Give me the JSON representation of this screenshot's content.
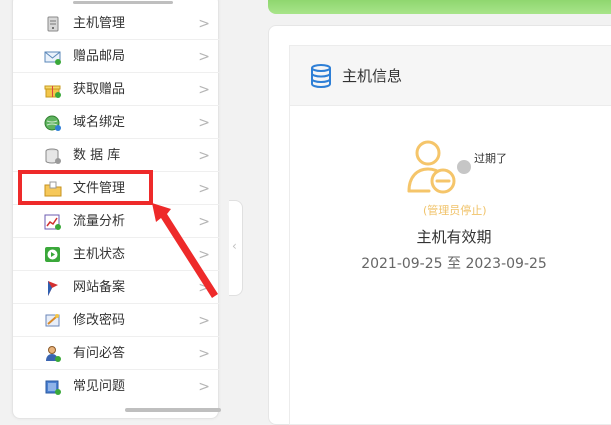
{
  "sidebar": {
    "items": [
      {
        "label": "主机管理",
        "icon": "server-icon"
      },
      {
        "label": "赠品邮局",
        "icon": "mail-icon"
      },
      {
        "label": "获取赠品",
        "icon": "gift-icon"
      },
      {
        "label": "域名绑定",
        "icon": "globe-icon"
      },
      {
        "label": "数 据 库",
        "icon": "database-icon"
      },
      {
        "label": "文件管理",
        "icon": "folder-icon"
      },
      {
        "label": "流量分析",
        "icon": "chart-icon"
      },
      {
        "label": "主机状态",
        "icon": "play-icon"
      },
      {
        "label": "网站备案",
        "icon": "flag-icon"
      },
      {
        "label": "修改密码",
        "icon": "key-icon"
      },
      {
        "label": "有问必答",
        "icon": "user-help-icon"
      },
      {
        "label": "常见问题",
        "icon": "faq-icon"
      }
    ],
    "chevron": ">"
  },
  "annotation": {
    "highlighted_item": "文件管理",
    "color": "#ee2a2a"
  },
  "panel": {
    "title": "主机信息",
    "status": "过期了",
    "admin_note": "(管理员停止)",
    "validity_label": "主机有效期",
    "validity_range": "2021-09-25 至 2023-09-25"
  },
  "colors": {
    "accent_green": "#8fd66f",
    "user_icon": "#f5c56a",
    "highlight": "#ee2a2a"
  }
}
